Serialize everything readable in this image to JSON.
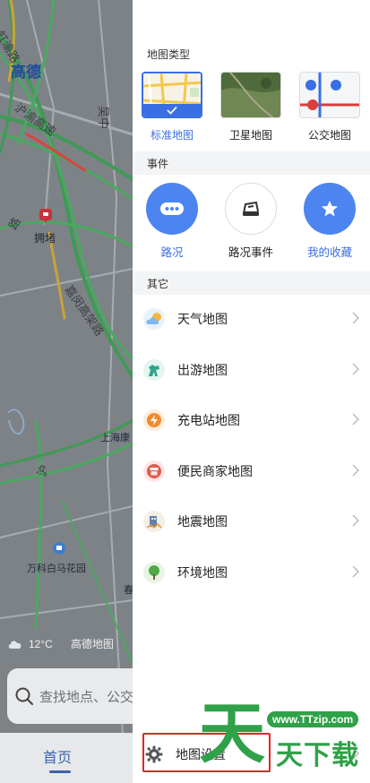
{
  "map": {
    "city_label": "高德",
    "road_labels": [
      "虹渝路",
      "沪渝高速",
      "嘉闵高架路",
      "吴中",
      "沪",
      "路"
    ],
    "congestion_label": "拥堵",
    "poi_labels": [
      "上海康",
      "万科白马花园",
      "春"
    ],
    "weather_temp": "12°C",
    "weather_brand": "高德地图",
    "search_placeholder": "查找地点、公交",
    "home_tab": "首页"
  },
  "panel": {
    "map_type_heading": "地图类型",
    "map_types": [
      {
        "label": "标准地图",
        "selected": true
      },
      {
        "label": "卫星地图",
        "selected": false
      },
      {
        "label": "公交地图",
        "selected": false
      }
    ],
    "event_heading": "事件",
    "events": [
      {
        "label": "路况",
        "icon": "traffic-dots-icon"
      },
      {
        "label": "路况事件",
        "icon": "car-accident-icon"
      },
      {
        "label": "我的收藏",
        "icon": "star-icon"
      }
    ],
    "other_heading": "其它",
    "other_items": [
      {
        "label": "天气地图",
        "icon": "weather-cloud-icon"
      },
      {
        "label": "出游地图",
        "icon": "travel-horse-icon"
      },
      {
        "label": "充电站地图",
        "icon": "charging-bolt-icon"
      },
      {
        "label": "便民商家地图",
        "icon": "shop-icon"
      },
      {
        "label": "地震地图",
        "icon": "earthquake-icon"
      },
      {
        "label": "环境地图",
        "icon": "tree-icon"
      }
    ],
    "settings_label": "地图设置"
  },
  "watermark": {
    "url": "www.TTzip.com",
    "glyph_1": "天",
    "text": "天下载"
  },
  "colors": {
    "accent": "#3a6fe3",
    "highlight": "#e0262a",
    "watermark": "#2fa148"
  }
}
